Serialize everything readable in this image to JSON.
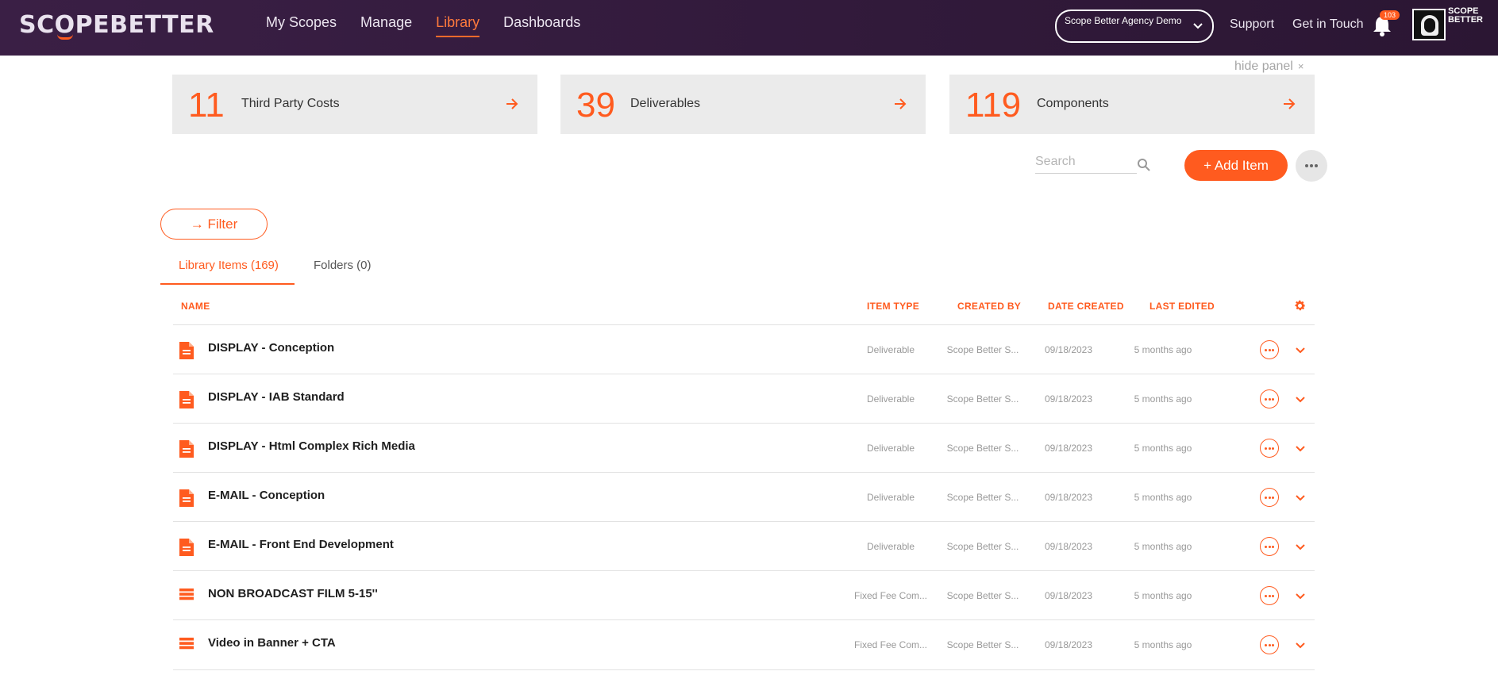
{
  "header": {
    "logo_left": "SC",
    "logo_o": "O",
    "logo_right": "PEBETTER",
    "nav": [
      {
        "label": "My Scopes"
      },
      {
        "label": "Manage"
      },
      {
        "label": "Library"
      },
      {
        "label": "Dashboards"
      }
    ],
    "active_nav": "Library",
    "org_select": "Scope Better Agency Demo",
    "support": "Support",
    "get_in_touch": "Get in Touch",
    "notification_count": "103",
    "mini_logo_line1": "SCOPE",
    "mini_logo_line2": "BETTER"
  },
  "panel": {
    "hide_label": "hide panel",
    "close_glyph": "×",
    "stats": [
      {
        "count": "11",
        "label": "Third Party Costs"
      },
      {
        "count": "39",
        "label": "Deliverables"
      },
      {
        "count": "119",
        "label": "Components"
      }
    ]
  },
  "toolbar": {
    "search_placeholder": "Search",
    "add_label": "+  Add Item",
    "filter_label": "→ Filter"
  },
  "tabs": [
    {
      "label": "Library Items (169)"
    },
    {
      "label": "Folders (0)"
    }
  ],
  "columns": {
    "name": "NAME",
    "item_type": "ITEM TYPE",
    "created_by": "CREATED BY",
    "date_created": "DATE CREATED",
    "last_edited": "LAST EDITED"
  },
  "colors": {
    "accent": "#ff5b1f",
    "header_bg": "#2f1838"
  },
  "rows": [
    {
      "icon": "document-icon",
      "name": "DISPLAY - Conception",
      "item_type": "Deliverable",
      "created_by": "Scope Better S...",
      "date_created": "09/18/2023",
      "last_edited": "5 months ago"
    },
    {
      "icon": "document-icon",
      "name": "DISPLAY - IAB Standard",
      "item_type": "Deliverable",
      "created_by": "Scope Better S...",
      "date_created": "09/18/2023",
      "last_edited": "5 months ago"
    },
    {
      "icon": "document-icon",
      "name": "DISPLAY - Html Complex Rich Media",
      "item_type": "Deliverable",
      "created_by": "Scope Better S...",
      "date_created": "09/18/2023",
      "last_edited": "5 months ago"
    },
    {
      "icon": "document-icon",
      "name": "E-MAIL - Conception",
      "item_type": "Deliverable",
      "created_by": "Scope Better S...",
      "date_created": "09/18/2023",
      "last_edited": "5 months ago"
    },
    {
      "icon": "document-icon",
      "name": "E-MAIL - Front End Development",
      "item_type": "Deliverable",
      "created_by": "Scope Better S...",
      "date_created": "09/18/2023",
      "last_edited": "5 months ago"
    },
    {
      "icon": "component-icon",
      "name": "NON BROADCAST FILM 5-15''",
      "item_type": "Fixed Fee Com...",
      "created_by": "Scope Better S...",
      "date_created": "09/18/2023",
      "last_edited": "5 months ago"
    },
    {
      "icon": "component-icon",
      "name": "Video in Banner + CTA",
      "item_type": "Fixed Fee Com...",
      "created_by": "Scope Better S...",
      "date_created": "09/18/2023",
      "last_edited": "5 months ago"
    }
  ]
}
